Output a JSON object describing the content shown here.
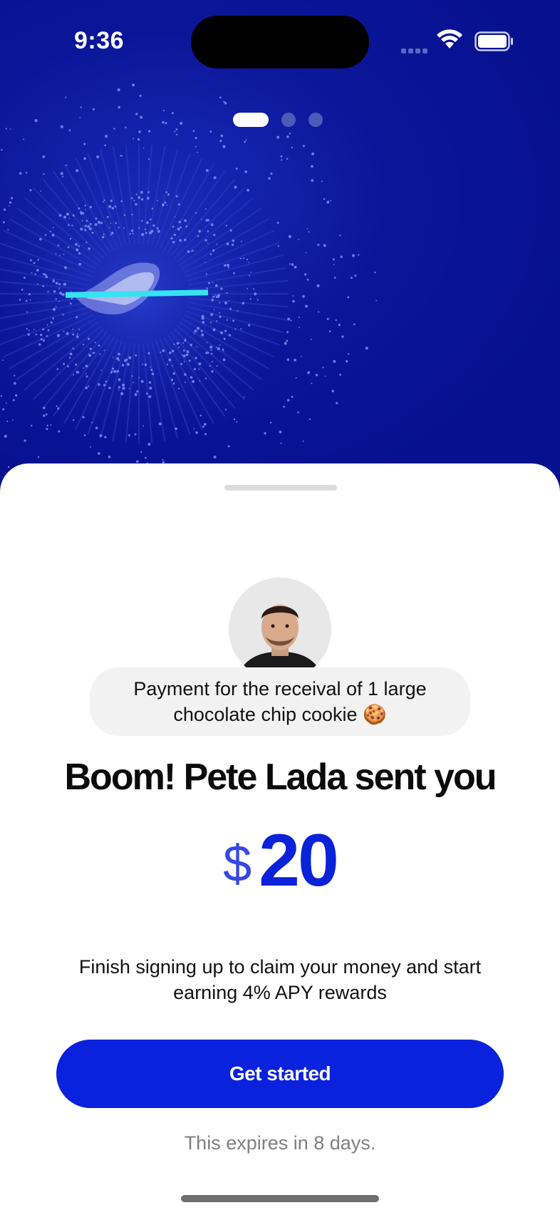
{
  "status_bar": {
    "time": "9:36"
  },
  "pager": {
    "page_count": 3,
    "current_page": 1
  },
  "icons": {
    "wifi": "wifi-icon",
    "battery": "battery-icon",
    "signal": "cellular-signal-icon",
    "cookie": "cookie-emoji"
  },
  "sheet": {
    "memo": "Payment for the receival of 1 large chocolate chip cookie 🍪",
    "headline": "Boom! Pete Lada sent you",
    "currency": "$",
    "amount": "20",
    "subtext": "Finish signing up to claim your money and start earning 4% APY rewards",
    "cta_label": "Get started",
    "expiry": "This expires in 8 days."
  },
  "colors": {
    "hero_bg": "#07118f",
    "accent": "#0a22dd",
    "sheet_bg": "#ffffff"
  }
}
